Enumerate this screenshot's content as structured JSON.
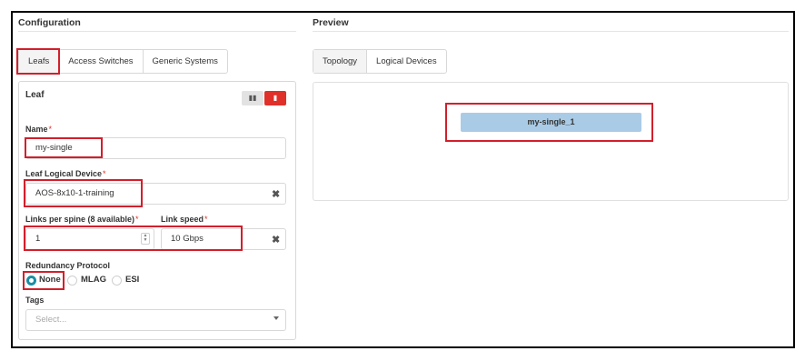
{
  "config": {
    "title": "Configuration",
    "tabs": [
      {
        "label": "Leafs"
      },
      {
        "label": "Access Switches"
      },
      {
        "label": "Generic Systems"
      }
    ]
  },
  "preview": {
    "title": "Preview",
    "tabs": [
      {
        "label": "Topology"
      },
      {
        "label": "Logical Devices"
      }
    ],
    "node_label": "my-single_1"
  },
  "leaf": {
    "title": "Leaf",
    "name_label": "Name",
    "name_value": "my-single",
    "logical_device_label": "Leaf Logical Device",
    "logical_device_value": "AOS-8x10-1-training",
    "links_label": "Links per spine (8 available)",
    "links_value": "1",
    "speed_label": "Link speed",
    "speed_value": "10 Gbps",
    "redundancy_label": "Redundancy Protocol",
    "redundancy_options": [
      {
        "label": "None",
        "selected": true
      },
      {
        "label": "MLAG",
        "selected": false
      },
      {
        "label": "ESI",
        "selected": false
      }
    ],
    "tags_label": "Tags",
    "tags_placeholder": "Select...",
    "required_mark": "*",
    "clear_glyph": "✖"
  },
  "colors": {
    "accent": "#1a8ea3",
    "highlight": "#d21f2b",
    "delete": "#e0302a",
    "node": "#a9cbe6"
  }
}
